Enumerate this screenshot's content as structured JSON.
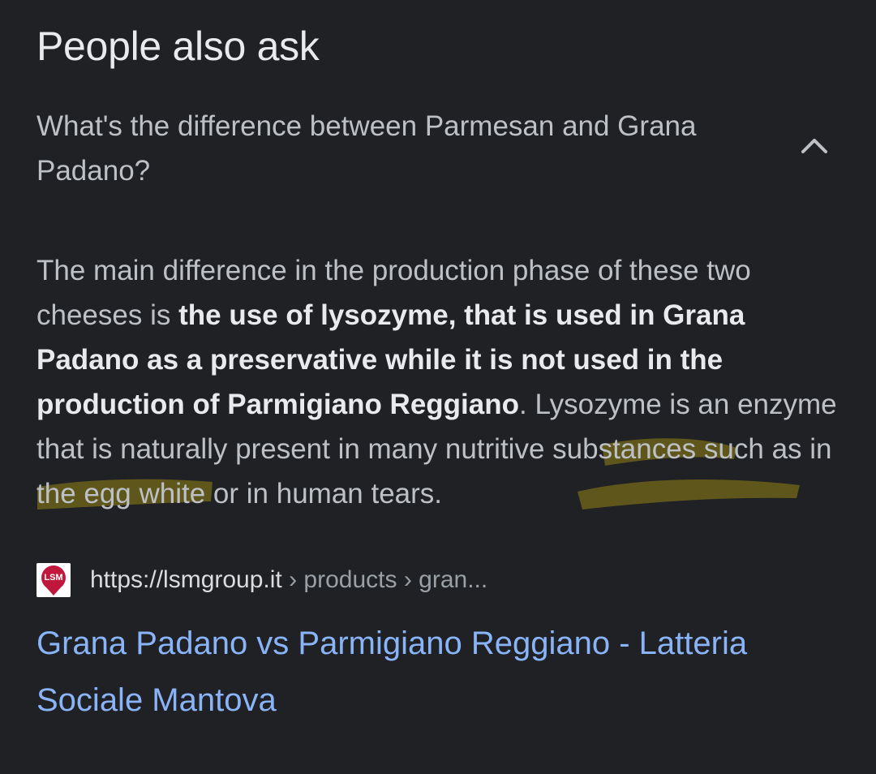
{
  "section": {
    "heading": "People also ask"
  },
  "question": {
    "text": "What's the difference between Parmesan and Grana Padano?",
    "expanded_icon": "chevron-up-icon"
  },
  "answer": {
    "part1": "The main difference in the production phase of these two cheeses is ",
    "bold": "the use of lysozyme, that is used in Grana Padano as a preservative while it is not used in the production of Parmigiano Reggiano",
    "part2": ". Lysozyme is an enzyme that is naturally present in many nutritive substances such as in the egg white or in human tears."
  },
  "source": {
    "favicon_text": "LSM",
    "domain": "https://lsmgroup.it",
    "breadcrumbs": " › products › gran...",
    "title": "Grana Padano vs Parmigiano Reggiano - Latteria Sociale Mantova"
  },
  "colors": {
    "background": "#202124",
    "heading": "#e8eaed",
    "text": "#bdc1c6",
    "link": "#8ab4f8",
    "highlighter": "#6b5f1a"
  }
}
